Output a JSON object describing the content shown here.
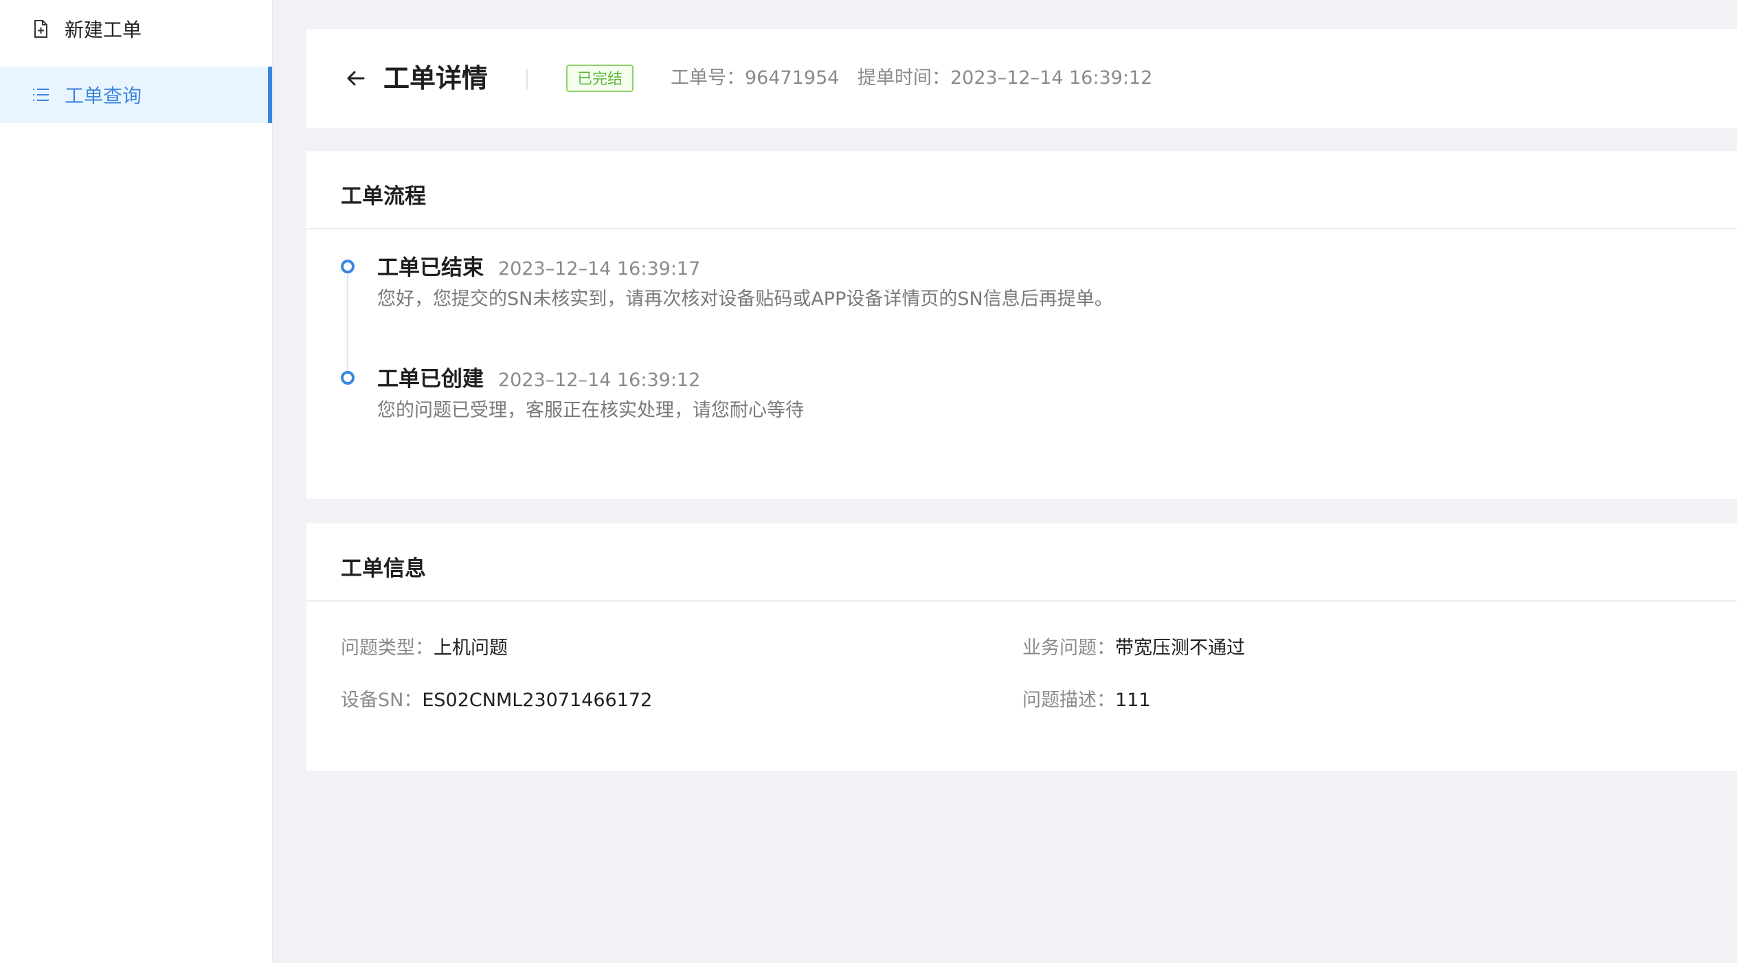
{
  "sidebar": {
    "items": [
      {
        "label": "新建工单",
        "icon": "file-plus-icon"
      },
      {
        "label": "工单查询",
        "icon": "list-icon",
        "active": true
      }
    ]
  },
  "header": {
    "title": "工单详情",
    "status": "已完结",
    "order_label": "工单号：",
    "order_no": "96471954",
    "time_label": "提单时间：",
    "time_value": "2023–12–14 16:39:12"
  },
  "flow": {
    "title": "工单流程",
    "events": [
      {
        "title": "工单已结束",
        "time": "2023–12–14 16:39:17",
        "desc": "您好，您提交的SN未核实到，请再次核对设备贴码或APP设备详情页的SN信息后再提单。"
      },
      {
        "title": "工单已创建",
        "time": "2023–12–14 16:39:12",
        "desc": "您的问题已受理，客服正在核实处理，请您耐心等待"
      }
    ]
  },
  "info": {
    "title": "工单信息",
    "fields": [
      {
        "label": "问题类型：",
        "value": "上机问题"
      },
      {
        "label": "业务问题：",
        "value": "带宽压测不通过"
      },
      {
        "label": "设备SN：",
        "value": "ES02CNML23071466172"
      },
      {
        "label": "问题描述：",
        "value": "111"
      }
    ]
  },
  "colors": {
    "accent": "#3a86e0",
    "status_green": "#5fb63a",
    "background": "#f0f2f5"
  }
}
